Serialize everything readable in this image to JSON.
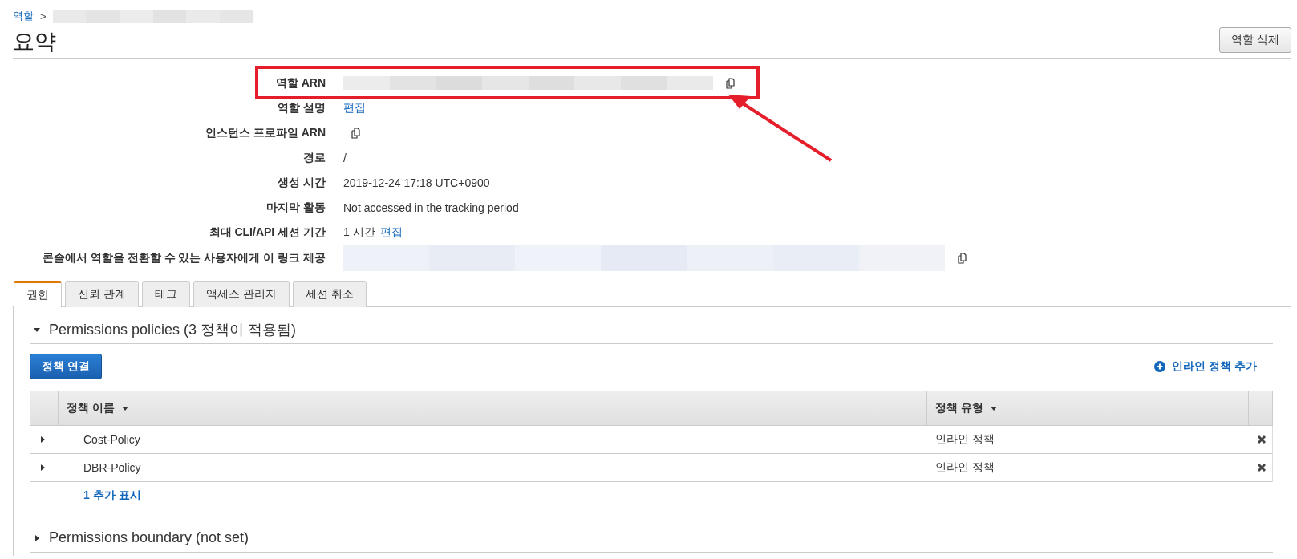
{
  "breadcrumb": {
    "link": "역할",
    "separator": ">"
  },
  "title": "요약",
  "delete_button": "역할 삭제",
  "summary": [
    {
      "label": "역할 ARN",
      "kind": "redacted",
      "copy": true,
      "highlighted": true
    },
    {
      "label": "역할 설명",
      "kind": "text",
      "link": "편집",
      "copy": false,
      "highlighted": false
    },
    {
      "label": "인스턴스 프로파일 ARN",
      "kind": "text",
      "copy": true,
      "highlighted": false
    },
    {
      "label": "경로",
      "kind": "text",
      "value": "/",
      "copy": false,
      "highlighted": false
    },
    {
      "label": "생성 시간",
      "kind": "text",
      "value": "2019-12-24 17:18 UTC+0900",
      "copy": false,
      "highlighted": false
    },
    {
      "label": "마지막 활동",
      "kind": "text",
      "value": "Not accessed in the tracking period",
      "copy": false,
      "highlighted": false
    },
    {
      "label": "최대 CLI/API 세션 기간",
      "kind": "text",
      "value": "1 시간",
      "link": "편집",
      "copy": false,
      "highlighted": false
    },
    {
      "label": "콘솔에서 역할을 전환할 수 있는 사용자에게 이 링크 제공",
      "kind": "redacted_tall",
      "copy": true,
      "highlighted": false
    }
  ],
  "tabs": [
    {
      "label": "권한",
      "selected": true
    },
    {
      "label": "신뢰 관계",
      "selected": false
    },
    {
      "label": "태그",
      "selected": false
    },
    {
      "label": "액세스 관리자",
      "selected": false
    },
    {
      "label": "세션 취소",
      "selected": false
    }
  ],
  "policies_section": {
    "title": "Permissions policies (3 정책이 적용됨)",
    "expanded": true,
    "attach_button": "정책 연결",
    "add_inline_link": "인라인 정책 추가",
    "table": {
      "columns": [
        "정책 이름",
        "정책 유형"
      ],
      "rows": [
        {
          "name": "Cost-Policy",
          "type": "인라인 정책",
          "expanded": false
        },
        {
          "name": "DBR-Policy",
          "type": "인라인 정책",
          "expanded": false
        }
      ]
    },
    "show_more": "1 추가 표시"
  },
  "boundary_section": {
    "title": "Permissions boundary (not set)",
    "expanded": false
  }
}
